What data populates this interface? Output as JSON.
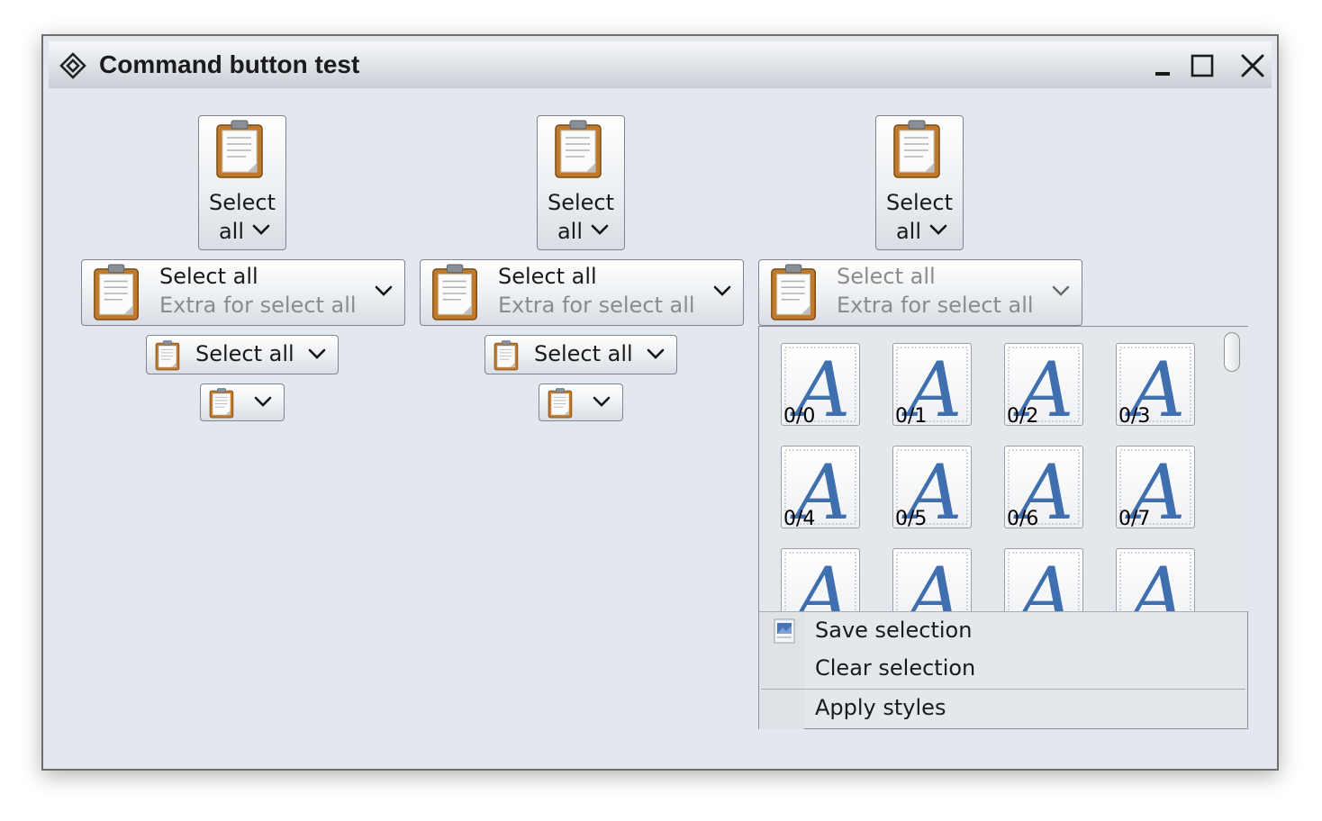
{
  "window": {
    "title": "Command button test",
    "controls": [
      "minimize-icon",
      "maximize-icon",
      "close-icon"
    ]
  },
  "columns": [
    {
      "big_button": {
        "line1": "Select",
        "line2": "all"
      },
      "medium_button": {
        "label": "Select all",
        "extra": "Extra for select all",
        "enabled": true
      },
      "small_button": {
        "label": "Select all"
      },
      "icon_button": {
        "icon": "clipboard-icon"
      }
    },
    {
      "big_button": {
        "line1": "Select",
        "line2": "all"
      },
      "medium_button": {
        "label": "Select all",
        "extra": "Extra for select all",
        "enabled": true
      },
      "small_button": {
        "label": "Select all"
      },
      "icon_button": {
        "icon": "clipboard-icon"
      }
    },
    {
      "big_button": {
        "line1": "Select",
        "line2": "all"
      },
      "medium_button": {
        "label": "Select all",
        "extra": "Extra for select all",
        "enabled": false
      }
    }
  ],
  "popup": {
    "gallery": [
      "0/0",
      "0/1",
      "0/2",
      "0/3",
      "0/4",
      "0/5",
      "0/6",
      "0/7",
      "",
      "",
      "",
      ""
    ],
    "gallery_glyph": "A",
    "menu": [
      {
        "label": "Save selection",
        "icon": "picture-icon"
      },
      {
        "label": "Clear selection"
      },
      {
        "label": "Apply styles"
      }
    ]
  },
  "colors": {
    "window_bg": "#e3e8ee",
    "glyph_blue": "#3f6fae",
    "clipboard_board": "#c07a2c",
    "disabled_text": "#8b8b8b"
  }
}
